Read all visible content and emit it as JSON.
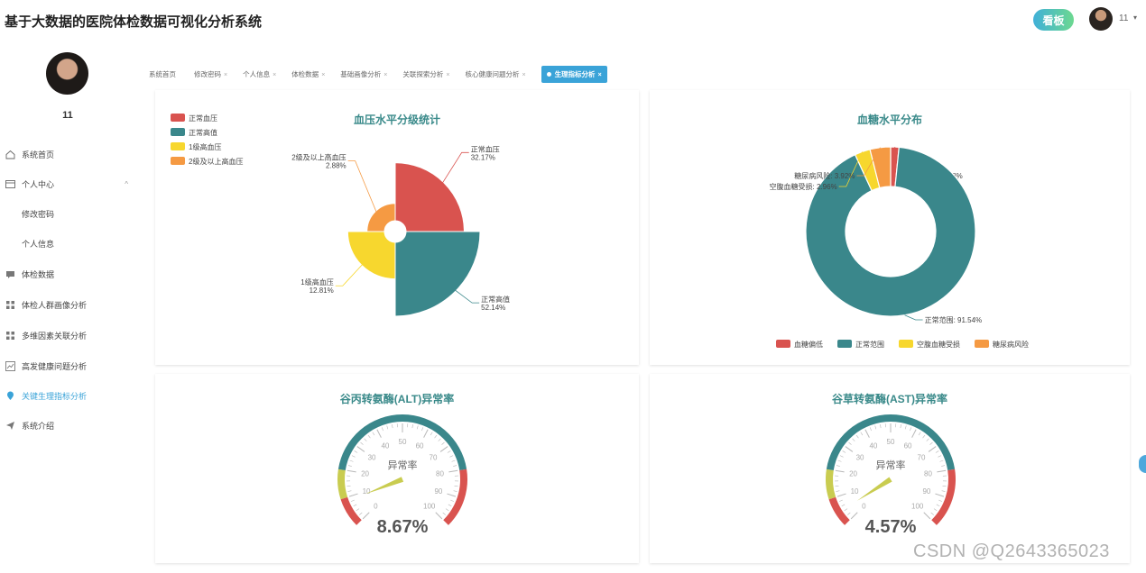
{
  "app": {
    "title": "基于大数据的医院体检数据可视化分析系统"
  },
  "topbar": {
    "kanban_label": "看板",
    "username": "11",
    "caret": "▾"
  },
  "sidebar": {
    "username": "11",
    "items": [
      {
        "label": "系统首页",
        "icon": "home-icon"
      },
      {
        "label": "个人中心",
        "icon": "profile-card-icon",
        "arrow": "^"
      },
      {
        "label": "修改密码",
        "sub": true
      },
      {
        "label": "个人信息",
        "sub": true
      },
      {
        "label": "体检数据",
        "icon": "chat-icon"
      },
      {
        "label": "体检人群画像分析",
        "icon": "grid-icon"
      },
      {
        "label": "多维因素关联分析",
        "icon": "grid-icon"
      },
      {
        "label": "高发健康问题分析",
        "icon": "trend-icon"
      },
      {
        "label": "关键生理指标分析",
        "icon": "location-pin-icon",
        "active": true
      },
      {
        "label": "系统介绍",
        "icon": "send-icon"
      }
    ]
  },
  "tabs": [
    {
      "label": "系统首页",
      "close": ""
    },
    {
      "label": "修改密码",
      "close": "×"
    },
    {
      "label": "个人信息",
      "close": "×"
    },
    {
      "label": "体检数据",
      "close": "×"
    },
    {
      "label": "基础画像分析",
      "close": "×"
    },
    {
      "label": "关联探索分析",
      "close": "×"
    },
    {
      "label": "核心健康问题分析",
      "close": "×"
    },
    {
      "label": "生理指标分析",
      "close": "×",
      "active": true
    }
  ],
  "colors": {
    "red": "#d9534f",
    "teal": "#3a878b",
    "yellow": "#f7d72e",
    "orange": "#f59a43",
    "accent": "#3aa3d8"
  },
  "chart_data": [
    {
      "type": "pie",
      "variant": "rose",
      "title": "血压水平分级统计",
      "legend_position": "top-left",
      "labels": [
        "正常血压",
        "正常高值",
        "1级高血压",
        "2级及以上高血压"
      ],
      "values": [
        32.17,
        52.14,
        12.81,
        2.88
      ],
      "value_labels": [
        "32.17%",
        "52.14%",
        "12.81%",
        "2.88%"
      ],
      "colors": [
        "#d9534f",
        "#3a878b",
        "#f7d72e",
        "#f59a43"
      ]
    },
    {
      "type": "pie",
      "variant": "donut",
      "title": "血糖水平分布",
      "legend_position": "bottom",
      "labels": [
        "血糖偏低",
        "正常范围",
        "空腹血糖受损",
        "糖尿病风险"
      ],
      "values": [
        1.58,
        91.54,
        2.96,
        3.92
      ],
      "slice_labels": [
        "血糖偏低: 1.58%",
        "正常范围: 91.54%",
        "空腹血糖受损: 2.96%",
        "糖尿病风险: 3.92%"
      ],
      "colors": [
        "#d9534f",
        "#3a878b",
        "#f7d72e",
        "#f59a43"
      ]
    },
    {
      "type": "gauge",
      "title": "谷丙转氨酶(ALT)异常率",
      "name": "异常率",
      "value": 8.67,
      "value_label": "8.67%",
      "min": 0,
      "max": 100,
      "ticks": [
        "0",
        "10",
        "20",
        "30",
        "40",
        "50",
        "60",
        "70",
        "80",
        "90",
        "100"
      ]
    },
    {
      "type": "gauge",
      "title": "谷草转氨酶(AST)异常率",
      "name": "异常率",
      "value": 4.57,
      "value_label": "4.57%",
      "min": 0,
      "max": 100,
      "ticks": [
        "0",
        "10",
        "20",
        "30",
        "40",
        "50",
        "60",
        "70",
        "80",
        "90",
        "100"
      ]
    }
  ],
  "watermark": "CSDN @Q2643365023"
}
